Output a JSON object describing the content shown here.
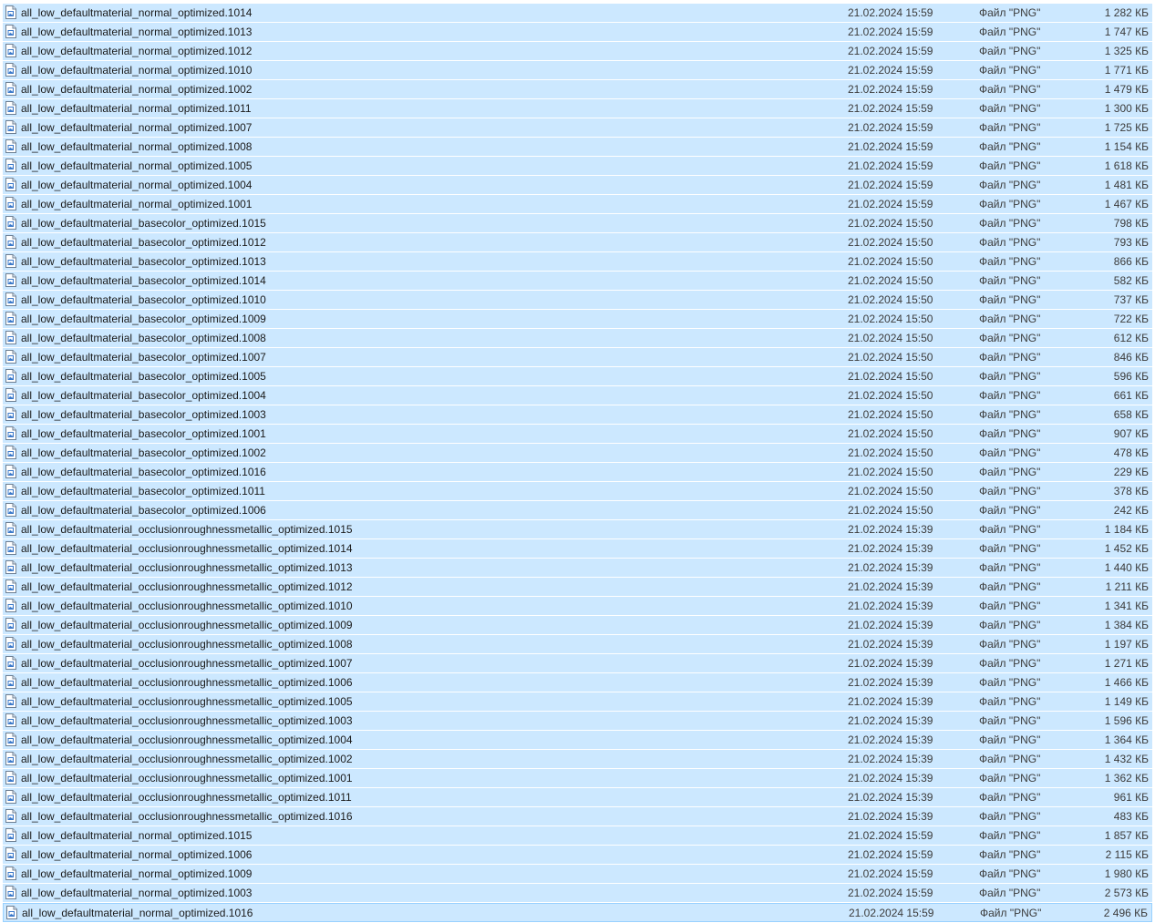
{
  "file_type": "Файл \"PNG\"",
  "files": [
    {
      "name": "all_low_defaultmaterial_normal_optimized.1014",
      "date": "21.02.2024 15:59",
      "size": "1 282 КБ"
    },
    {
      "name": "all_low_defaultmaterial_normal_optimized.1013",
      "date": "21.02.2024 15:59",
      "size": "1 747 КБ"
    },
    {
      "name": "all_low_defaultmaterial_normal_optimized.1012",
      "date": "21.02.2024 15:59",
      "size": "1 325 КБ"
    },
    {
      "name": "all_low_defaultmaterial_normal_optimized.1010",
      "date": "21.02.2024 15:59",
      "size": "1 771 КБ"
    },
    {
      "name": "all_low_defaultmaterial_normal_optimized.1002",
      "date": "21.02.2024 15:59",
      "size": "1 479 КБ"
    },
    {
      "name": "all_low_defaultmaterial_normal_optimized.1011",
      "date": "21.02.2024 15:59",
      "size": "1 300 КБ"
    },
    {
      "name": "all_low_defaultmaterial_normal_optimized.1007",
      "date": "21.02.2024 15:59",
      "size": "1 725 КБ"
    },
    {
      "name": "all_low_defaultmaterial_normal_optimized.1008",
      "date": "21.02.2024 15:59",
      "size": "1 154 КБ"
    },
    {
      "name": "all_low_defaultmaterial_normal_optimized.1005",
      "date": "21.02.2024 15:59",
      "size": "1 618 КБ"
    },
    {
      "name": "all_low_defaultmaterial_normal_optimized.1004",
      "date": "21.02.2024 15:59",
      "size": "1 481 КБ"
    },
    {
      "name": "all_low_defaultmaterial_normal_optimized.1001",
      "date": "21.02.2024 15:59",
      "size": "1 467 КБ"
    },
    {
      "name": "all_low_defaultmaterial_basecolor_optimized.1015",
      "date": "21.02.2024 15:50",
      "size": "798 КБ"
    },
    {
      "name": "all_low_defaultmaterial_basecolor_optimized.1012",
      "date": "21.02.2024 15:50",
      "size": "793 КБ"
    },
    {
      "name": "all_low_defaultmaterial_basecolor_optimized.1013",
      "date": "21.02.2024 15:50",
      "size": "866 КБ"
    },
    {
      "name": "all_low_defaultmaterial_basecolor_optimized.1014",
      "date": "21.02.2024 15:50",
      "size": "582 КБ"
    },
    {
      "name": "all_low_defaultmaterial_basecolor_optimized.1010",
      "date": "21.02.2024 15:50",
      "size": "737 КБ"
    },
    {
      "name": "all_low_defaultmaterial_basecolor_optimized.1009",
      "date": "21.02.2024 15:50",
      "size": "722 КБ"
    },
    {
      "name": "all_low_defaultmaterial_basecolor_optimized.1008",
      "date": "21.02.2024 15:50",
      "size": "612 КБ"
    },
    {
      "name": "all_low_defaultmaterial_basecolor_optimized.1007",
      "date": "21.02.2024 15:50",
      "size": "846 КБ"
    },
    {
      "name": "all_low_defaultmaterial_basecolor_optimized.1005",
      "date": "21.02.2024 15:50",
      "size": "596 КБ"
    },
    {
      "name": "all_low_defaultmaterial_basecolor_optimized.1004",
      "date": "21.02.2024 15:50",
      "size": "661 КБ"
    },
    {
      "name": "all_low_defaultmaterial_basecolor_optimized.1003",
      "date": "21.02.2024 15:50",
      "size": "658 КБ"
    },
    {
      "name": "all_low_defaultmaterial_basecolor_optimized.1001",
      "date": "21.02.2024 15:50",
      "size": "907 КБ"
    },
    {
      "name": "all_low_defaultmaterial_basecolor_optimized.1002",
      "date": "21.02.2024 15:50",
      "size": "478 КБ"
    },
    {
      "name": "all_low_defaultmaterial_basecolor_optimized.1016",
      "date": "21.02.2024 15:50",
      "size": "229 КБ"
    },
    {
      "name": "all_low_defaultmaterial_basecolor_optimized.1011",
      "date": "21.02.2024 15:50",
      "size": "378 КБ"
    },
    {
      "name": "all_low_defaultmaterial_basecolor_optimized.1006",
      "date": "21.02.2024 15:50",
      "size": "242 КБ"
    },
    {
      "name": "all_low_defaultmaterial_occlusionroughnessmetallic_optimized.1015",
      "date": "21.02.2024 15:39",
      "size": "1 184 КБ"
    },
    {
      "name": "all_low_defaultmaterial_occlusionroughnessmetallic_optimized.1014",
      "date": "21.02.2024 15:39",
      "size": "1 452 КБ"
    },
    {
      "name": "all_low_defaultmaterial_occlusionroughnessmetallic_optimized.1013",
      "date": "21.02.2024 15:39",
      "size": "1 440 КБ"
    },
    {
      "name": "all_low_defaultmaterial_occlusionroughnessmetallic_optimized.1012",
      "date": "21.02.2024 15:39",
      "size": "1 211 КБ"
    },
    {
      "name": "all_low_defaultmaterial_occlusionroughnessmetallic_optimized.1010",
      "date": "21.02.2024 15:39",
      "size": "1 341 КБ"
    },
    {
      "name": "all_low_defaultmaterial_occlusionroughnessmetallic_optimized.1009",
      "date": "21.02.2024 15:39",
      "size": "1 384 КБ"
    },
    {
      "name": "all_low_defaultmaterial_occlusionroughnessmetallic_optimized.1008",
      "date": "21.02.2024 15:39",
      "size": "1 197 КБ"
    },
    {
      "name": "all_low_defaultmaterial_occlusionroughnessmetallic_optimized.1007",
      "date": "21.02.2024 15:39",
      "size": "1 271 КБ"
    },
    {
      "name": "all_low_defaultmaterial_occlusionroughnessmetallic_optimized.1006",
      "date": "21.02.2024 15:39",
      "size": "1 466 КБ"
    },
    {
      "name": "all_low_defaultmaterial_occlusionroughnessmetallic_optimized.1005",
      "date": "21.02.2024 15:39",
      "size": "1 149 КБ"
    },
    {
      "name": "all_low_defaultmaterial_occlusionroughnessmetallic_optimized.1003",
      "date": "21.02.2024 15:39",
      "size": "1 596 КБ"
    },
    {
      "name": "all_low_defaultmaterial_occlusionroughnessmetallic_optimized.1004",
      "date": "21.02.2024 15:39",
      "size": "1 364 КБ"
    },
    {
      "name": "all_low_defaultmaterial_occlusionroughnessmetallic_optimized.1002",
      "date": "21.02.2024 15:39",
      "size": "1 432 КБ"
    },
    {
      "name": "all_low_defaultmaterial_occlusionroughnessmetallic_optimized.1001",
      "date": "21.02.2024 15:39",
      "size": "1 362 КБ"
    },
    {
      "name": "all_low_defaultmaterial_occlusionroughnessmetallic_optimized.1011",
      "date": "21.02.2024 15:39",
      "size": "961 КБ"
    },
    {
      "name": "all_low_defaultmaterial_occlusionroughnessmetallic_optimized.1016",
      "date": "21.02.2024 15:39",
      "size": "483 КБ"
    },
    {
      "name": "all_low_defaultmaterial_normal_optimized.1015",
      "date": "21.02.2024 15:59",
      "size": "1 857 КБ"
    },
    {
      "name": "all_low_defaultmaterial_normal_optimized.1006",
      "date": "21.02.2024 15:59",
      "size": "2 115 КБ"
    },
    {
      "name": "all_low_defaultmaterial_normal_optimized.1009",
      "date": "21.02.2024 15:59",
      "size": "1 980 КБ"
    },
    {
      "name": "all_low_defaultmaterial_normal_optimized.1003",
      "date": "21.02.2024 15:59",
      "size": "2 573 КБ"
    },
    {
      "name": "all_low_defaultmaterial_normal_optimized.1016",
      "date": "21.02.2024 15:59",
      "size": "2 496 КБ"
    }
  ],
  "icon": "png-file-icon",
  "colors": {
    "selection": "#cce8ff",
    "focus_border": "#99d1ff",
    "text": "#1a1a1a",
    "secondary_text": "#3b3b3b"
  }
}
